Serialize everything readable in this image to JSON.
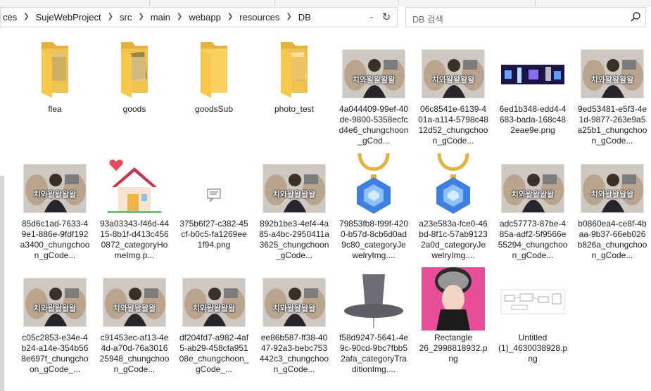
{
  "address": {
    "crumbs": [
      "ces",
      "SujeWebProject",
      "src",
      "main",
      "webapp",
      "resources",
      "DB"
    ]
  },
  "search": {
    "placeholder": "DB 검색"
  },
  "thumb_caption": "치와왈왈왈왈",
  "files": [
    {
      "label": "flea",
      "kind": "folder-photo",
      "id": "flea"
    },
    {
      "label": "goods",
      "kind": "folder-photo",
      "id": "goods"
    },
    {
      "label": "goodsSub",
      "kind": "folder",
      "id": "goodsSub"
    },
    {
      "label": "photo_test",
      "kind": "folder-photo",
      "id": "photo-test"
    },
    {
      "label": "4a044409-99ef-40de-9800-5358ecfcd4e6_chungchoon_gCod...",
      "kind": "person",
      "id": "4a044409"
    },
    {
      "label": "06c8541e-6139-401a-a114-5798c4812d52_chungchoon_gCode...",
      "kind": "person",
      "id": "06c8541e"
    },
    {
      "label": "6ed1b348-edd4-4683-bada-168c482eae9e.png",
      "kind": "concert",
      "id": "6ed1b348"
    },
    {
      "label": "9ed53481-e5f3-4e1d-9877-263e9a5a25b1_chungchoon_gCode...",
      "kind": "person",
      "id": "9ed53481"
    },
    {
      "label": "85d6c1ad-7633-49e1-886e-9fdf192a3400_chungchoon_gCode...",
      "kind": "person",
      "id": "85d6c1ad"
    },
    {
      "label": "93a03343-f46d-4415-8b1f-d413c4560872_categoryHomeImg.p...",
      "kind": "home",
      "id": "93a03343"
    },
    {
      "label": "375b6f27-c382-45cf-b0c5-fa1269ee1f94.png",
      "kind": "chat",
      "id": "375b6f27"
    },
    {
      "label": "892b1be3-4ef4-4a85-a4bc-2950411a3625_chungchoon_gCode...",
      "kind": "person",
      "id": "892b1be3"
    },
    {
      "label": "79853fb8-f99f-4200-b57d-8cb6d0ad9c80_categoryJewelryImg....",
      "kind": "jewel",
      "id": "79853fb8"
    },
    {
      "label": "a23e583a-fce0-46bd-8f1c-57ab91232a0d_categoryJewelryImg....",
      "kind": "jewel",
      "id": "a23e583a"
    },
    {
      "label": "adc57773-87be-485a-adf2-5f9566e55294_chungchoon_gCode...",
      "kind": "person",
      "id": "adc57773"
    },
    {
      "label": "b0860ea4-ce8f-4baa-9b37-66eb026b826a_chungchoon_gCode...",
      "kind": "person",
      "id": "b0860ea4"
    },
    {
      "label": "c05c2853-e34e-4b24-a14e-354b568e697f_chungchoon_gCode_...",
      "kind": "person",
      "id": "c05c2853"
    },
    {
      "label": "c91453ec-af13-4e4d-a70d-76a301625948_chungchoon_gCode...",
      "kind": "person",
      "id": "c91453ec"
    },
    {
      "label": "df204fd7-a982-4af5-ab29-458cfa95108e_chungchoon_gCode_...",
      "kind": "person",
      "id": "df204fd7"
    },
    {
      "label": "ee86b587-ff38-4047-92a3-bebc753442c3_chungchoon_gCode...",
      "kind": "person",
      "id": "ee86b587"
    },
    {
      "label": "f58d9247-5641-4e9c-90cd-9bc7fbb52afa_categoryTraditionImg....",
      "kind": "hat",
      "id": "f58d9247"
    },
    {
      "label": "Rectangle\n26_2998818932.png",
      "kind": "portrait",
      "id": "rectangle-26"
    },
    {
      "label": "Untitled\n(1)_4630038928.png",
      "kind": "diagram",
      "id": "untitled-1"
    }
  ]
}
